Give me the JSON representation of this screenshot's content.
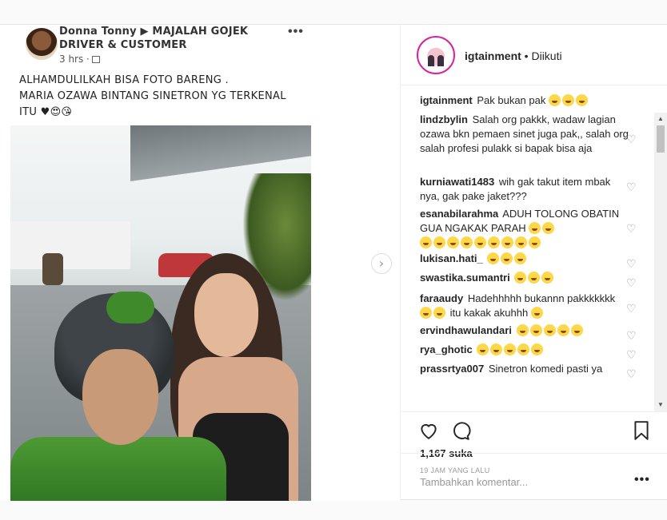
{
  "fb_post": {
    "author_line1": "Donna Tonny ▶ MAJALAH GOJEK",
    "author_line2": "DRIVER & CUSTOMER",
    "time": "3 hrs ·",
    "more": "•••",
    "text_line1": "ALHAMDULILKAH BISA FOTO BARENG .",
    "text_line2": "MARIA OZAWA BINTANG SINETRON YG TERKENAL",
    "text_line3": "ITU ♥😍😘"
  },
  "carousel": {
    "next": "›"
  },
  "header": {
    "username": "igtainment",
    "separator": " • ",
    "follow_status": "Diikuti"
  },
  "comments": [
    {
      "user": "igtainment",
      "text": "Pak bukan pak",
      "emoji": 3,
      "like": false
    },
    {
      "user": "lindzbylin",
      "text": "Salah org pakkk, wadaw lagian ozawa bkn pemaen sinet juga pak,, salah org salah profesi pulakk si bapak bisa aja",
      "emoji": 0,
      "like": true
    },
    {
      "user": "kurniawati1483",
      "text": "wih gak takut item mbak nya, gak pake jaket???",
      "emoji": 0,
      "like": true
    },
    {
      "user": "esanabilarahma",
      "text": "ADUH TOLONG OBATIN GUA NGAKAK PARAH",
      "emoji": 2,
      "emoji2": 9,
      "like": true
    },
    {
      "user": "lukisan.hati_",
      "text": "",
      "emoji": 3,
      "like": true
    },
    {
      "user": "swastika.sumantri",
      "text": "",
      "emoji": 3,
      "like": true
    },
    {
      "user": "faraaudy",
      "text": "Hadehhhhh bukannn pakkkkkkk",
      "emoji": 2,
      "text2": "itu kakak akuhhh",
      "emoji3": 1,
      "like": true
    },
    {
      "user": "ervindhawulandari",
      "text": "",
      "emoji": 5,
      "like": true
    },
    {
      "user": "rya_ghotic",
      "text": "",
      "emoji": 5,
      "like": true
    },
    {
      "user": "prassrtya007",
      "text": "Sinetron komedi pasti ya",
      "emoji": 0,
      "like": true
    }
  ],
  "actions": {
    "likes": "1,167 suka",
    "time_ago": "19 JAM YANG LALU",
    "add_comment_placeholder": "Tambahkan komentar...",
    "more": "•••"
  },
  "scroll": {
    "up": "▲",
    "down": "▼"
  },
  "colors": {
    "accent": "#262626",
    "muted": "#999999",
    "border": "#efefef"
  }
}
